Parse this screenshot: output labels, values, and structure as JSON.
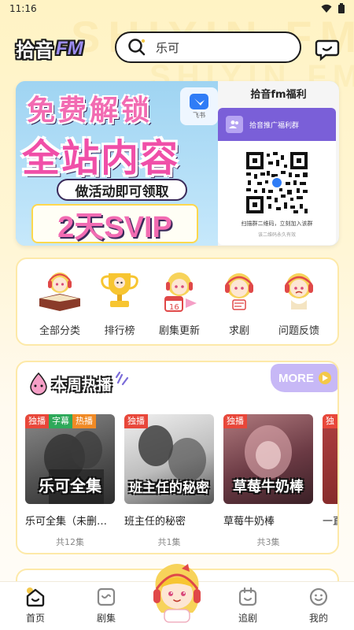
{
  "status_bar": {
    "time": "11:16"
  },
  "watermark": {
    "line1": "SHIYIN FM",
    "line2": "SHIYIN FM"
  },
  "header": {
    "logo_cn": "拾音",
    "logo_fm": "FM",
    "search_value": "乐可"
  },
  "banner": {
    "headline1": "免费解锁",
    "headline2": "全站内容",
    "subline": "做活动即可领取",
    "promo": "2天SVIP",
    "feishu_label": "飞书",
    "group_title": "拾音fm福利",
    "group_name": "拾音推广福利群",
    "scan_text": "扫描群二维码，立刻加入该群",
    "valid_text": "该二维码永久有效"
  },
  "quick_menu": [
    {
      "label": "全部分类",
      "icon": "book-mascot-icon"
    },
    {
      "label": "排行榜",
      "icon": "trophy-icon"
    },
    {
      "label": "剧集更新",
      "icon": "calendar-mascot-icon"
    },
    {
      "label": "求剧",
      "icon": "request-mascot-icon"
    },
    {
      "label": "问题反馈",
      "icon": "feedback-mascot-icon"
    }
  ],
  "hot_section": {
    "title": "本周热播",
    "more_label": "MORE"
  },
  "dramas": [
    {
      "tags": [
        "独播",
        "字幕",
        "热播"
      ],
      "cover_title": "乐可全集",
      "name": "乐可全集（未删…",
      "count": "共12集",
      "cover_color": "#6f6f6f"
    },
    {
      "tags": [
        "独播"
      ],
      "cover_title": "班主任的秘密",
      "name": "班主任的秘密",
      "count": "共1集",
      "cover_color": "#cfcfcf"
    },
    {
      "tags": [
        "独播"
      ],
      "cover_title": "草莓牛奶棒",
      "name": "草莓牛奶棒",
      "count": "共3集",
      "cover_color": "#7a4a4f"
    },
    {
      "tags": [
        "独"
      ],
      "cover_title": "",
      "name": "一直",
      "count": "",
      "cover_color": "#8a2e2e"
    }
  ],
  "tabbar": [
    {
      "label": "首页",
      "icon": "home-icon"
    },
    {
      "label": "剧集",
      "icon": "drama-icon"
    },
    {
      "label": "追剧",
      "icon": "follow-icon"
    },
    {
      "label": "我的",
      "icon": "profile-icon"
    }
  ],
  "colors": {
    "accent_purple": "#c7b8f6",
    "brand_pink": "#f04fa8",
    "tag_red": "#e8473a",
    "tag_green": "#2ea95a",
    "tag_orange": "#f08a25",
    "card_border": "#fde9a8"
  }
}
